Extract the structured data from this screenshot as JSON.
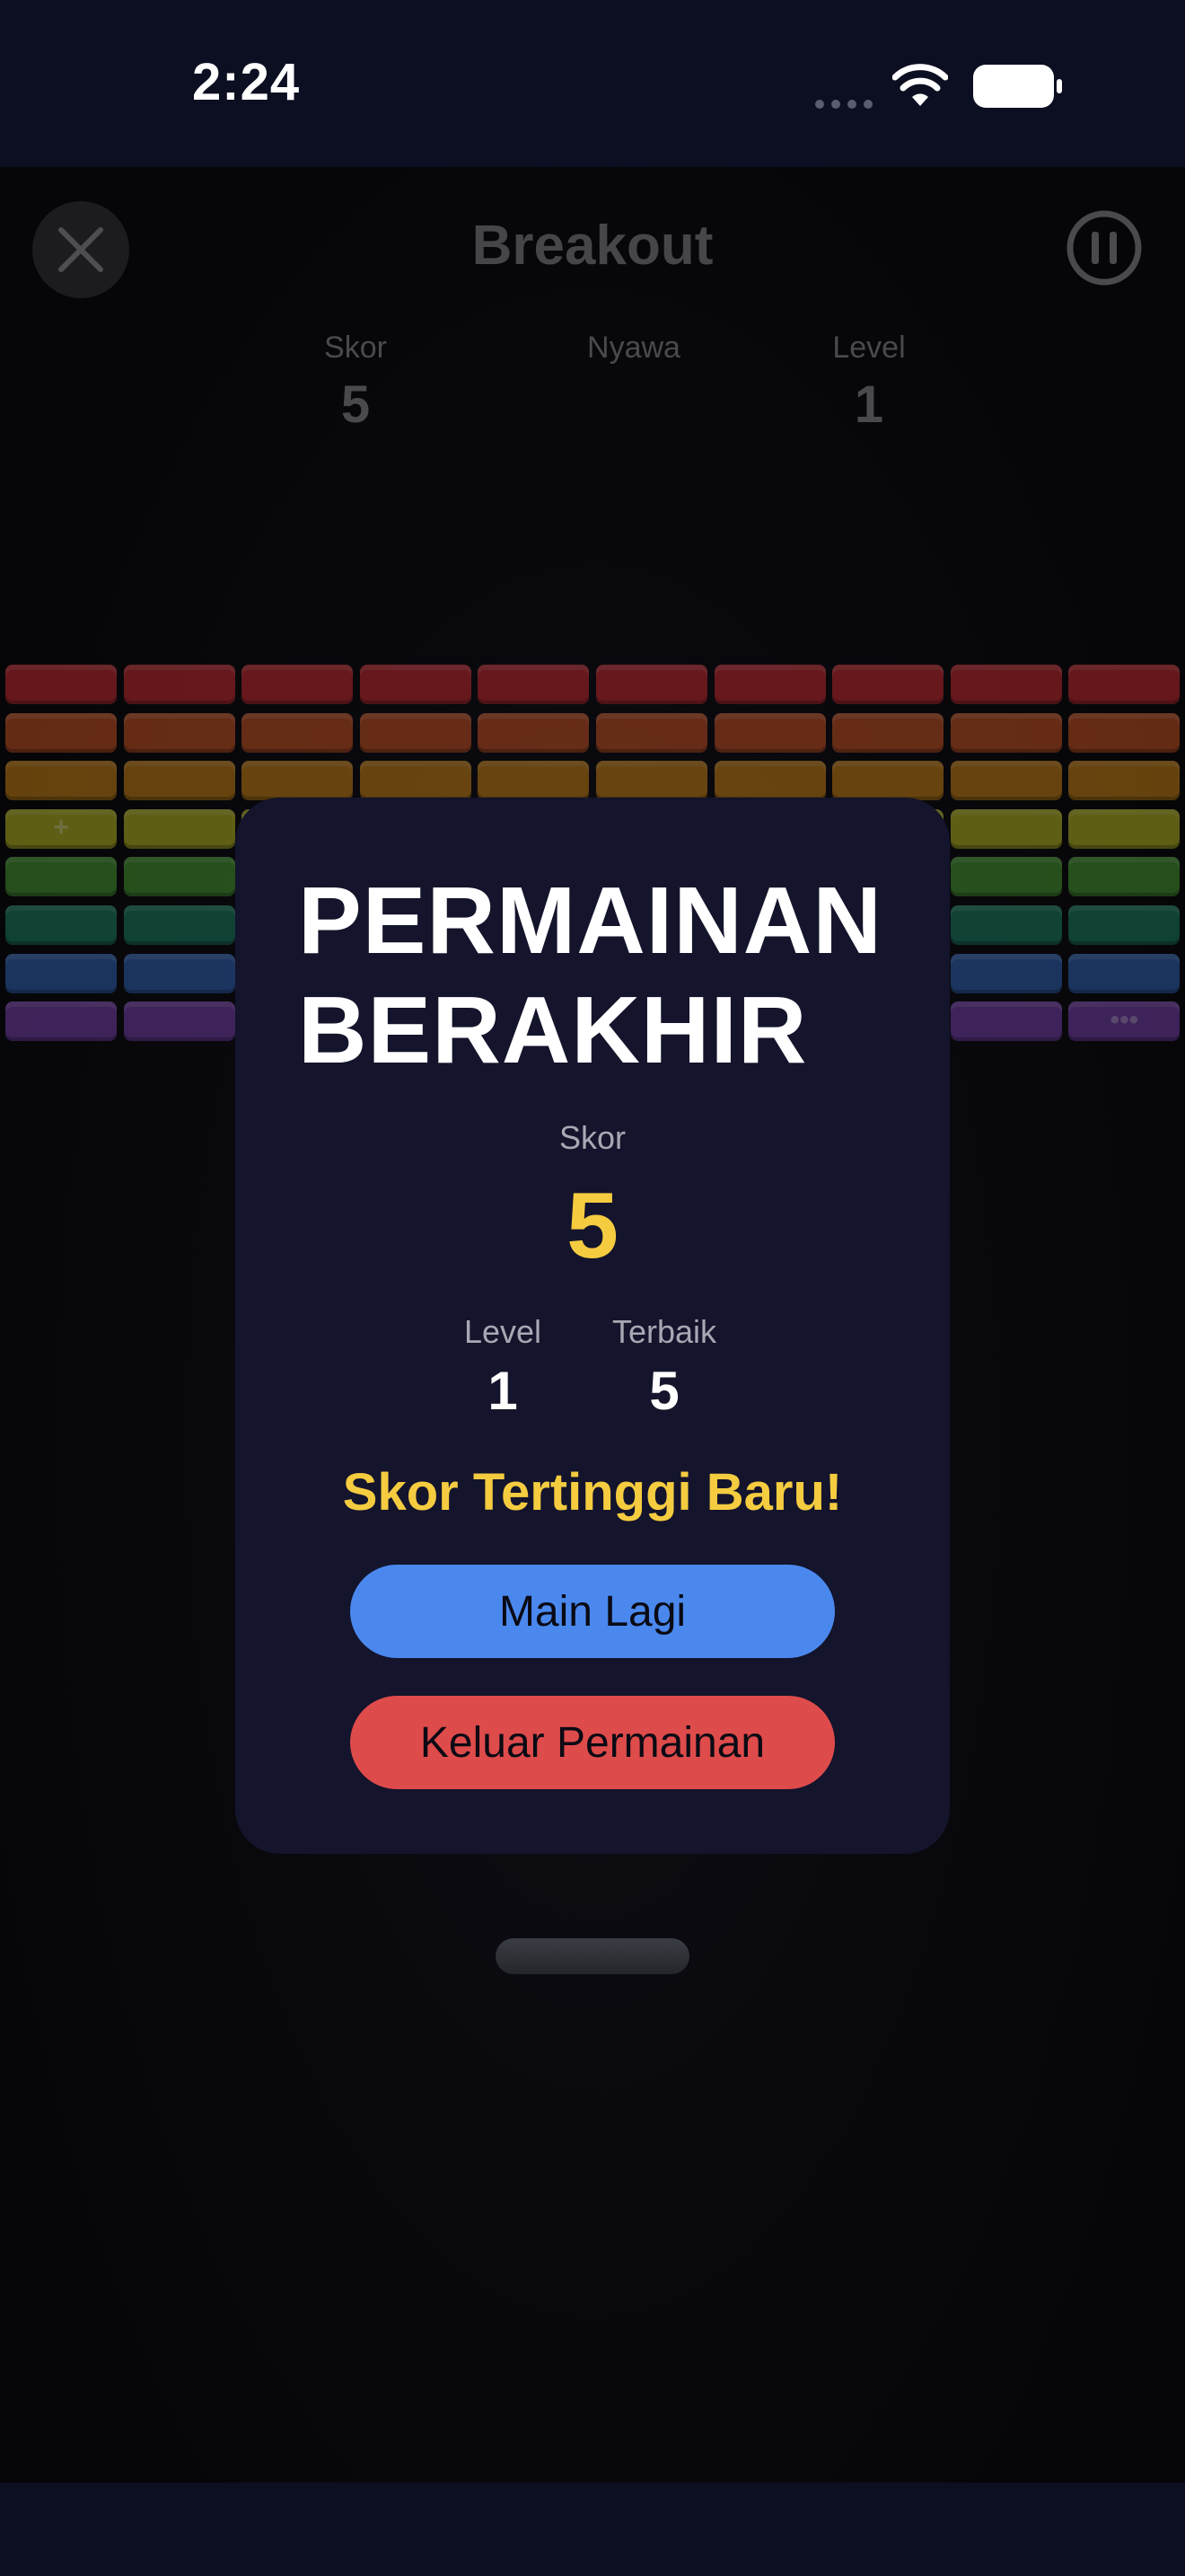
{
  "status_bar": {
    "time": "2:24"
  },
  "header": {
    "title": "Breakout"
  },
  "hud": {
    "score": {
      "label": "Skor",
      "value": "5"
    },
    "lives": {
      "label": "Nyawa",
      "value": ""
    },
    "level": {
      "label": "Level",
      "value": "1"
    }
  },
  "bricks": {
    "row_colors": [
      "#b3262b",
      "#b24a1f",
      "#b47412",
      "#a6a51e",
      "#3f8a2c",
      "#187259",
      "#2b5aa4",
      "#6b3a9c"
    ],
    "powerup_marks": [
      {
        "row": 3,
        "col": 0,
        "glyph": "+"
      },
      {
        "row": 7,
        "col": 9,
        "glyph": "•••"
      }
    ]
  },
  "modal": {
    "title_line1": "PERMAINAN",
    "title_line2": "BERAKHIR",
    "score_label": "Skor",
    "score_value": "5",
    "level_label": "Level",
    "level_value": "1",
    "best_label": "Terbaik",
    "best_value": "5",
    "highscore_text": "Skor Tertinggi Baru!",
    "play_again_label": "Main Lagi",
    "quit_label": "Keluar Permainan"
  },
  "colors": {
    "accent_gold": "#f5cc40",
    "play_button": "#4a88ee",
    "quit_button": "#de4b4b",
    "modal_bg": "#14142c"
  }
}
